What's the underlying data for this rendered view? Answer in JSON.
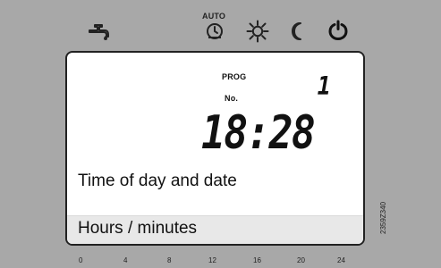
{
  "header": {
    "auto_label": "AUTO",
    "icons": [
      {
        "name": "water-tap-icon"
      },
      {
        "name": "auto-clock-icon"
      },
      {
        "name": "sun-icon"
      },
      {
        "name": "moon-icon"
      },
      {
        "name": "power-icon"
      }
    ]
  },
  "screen": {
    "prog_label": "PROG",
    "no_label": "No.",
    "program_number": "1",
    "time": "18:28",
    "line1": "Time of day and date",
    "line2": "Hours / minutes"
  },
  "scale": {
    "ticks": [
      "0",
      "4",
      "8",
      "12",
      "16",
      "20",
      "24"
    ],
    "code": "2359Z340"
  }
}
